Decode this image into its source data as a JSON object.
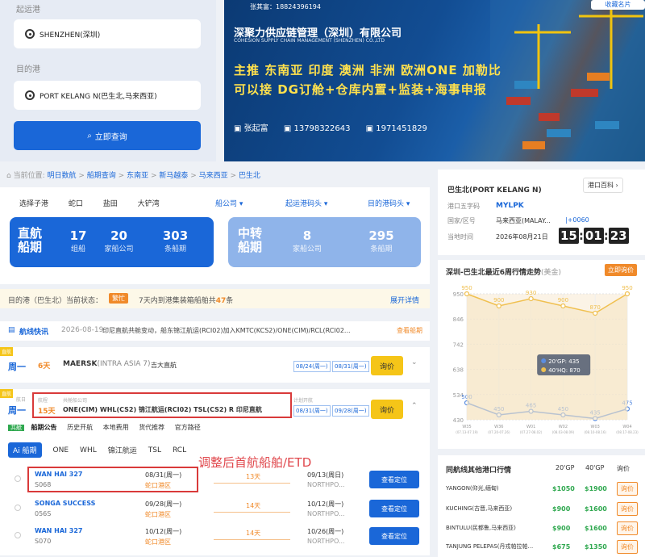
{
  "search": {
    "origin_label": "起运港",
    "origin_value": "SHENZHEN(深圳)",
    "dest_label": "目的港",
    "dest_value": "PORT KELANG N(巴生北,马来西亚)",
    "query_button": "立即查询"
  },
  "banner": {
    "contact_top": "张其富：18824396194",
    "company_cn": "深聚力供应链管理（深圳）有限公司",
    "company_en": "COHESION SUPPLY CHAIN MANAGEMENT (SHENZHEN) CO.,LTD",
    "line1": "主推  东南亚  印度  澳洲  非洲  欧洲ONE  加勒比",
    "line2": "可以接  DG订舱+仓库内置+监装+海事申报",
    "contact_name": "张起富",
    "phone": "13798322643",
    "qq": "1971451829",
    "save_card": "收藏名片"
  },
  "breadcrumb": {
    "prefix": "当前位置:",
    "items": [
      "明日数航",
      "船期查询",
      "东南亚",
      "新马越泰",
      "马来西亚",
      "巴生北"
    ],
    "sep": ">"
  },
  "filters": {
    "ports": [
      "选择子港",
      "蛇口",
      "盐田",
      "大铲湾"
    ],
    "dropdowns": [
      "船公司 ▾",
      "起运港码头 ▾",
      "目的港码头 ▾"
    ]
  },
  "direct": {
    "title1": "直航",
    "title2": "船期",
    "groups": "17",
    "groups_unit": "组船",
    "carriers": "20",
    "carriers_unit": "家船公司",
    "schedules": "303",
    "schedules_unit": "条船期"
  },
  "transit": {
    "title1": "中转",
    "title2": "船期",
    "carriers": "8",
    "carriers_unit": "家船公司",
    "schedules": "295",
    "schedules_unit": "条船期"
  },
  "port_status": {
    "text": "目的港（巴生北）当前状态：",
    "badge": "繁忙",
    "desc_pre": "7天内到港集装箱船舶共",
    "count": "47",
    "desc_post": "条",
    "detail": "展开详情"
  },
  "news": {
    "label": "航线快讯",
    "date": "2026-08-19",
    "text": "印尼直航共舱变动，船东锦江航运(RCI02)加入KMTC(KCS2)/ONE(CIM)/RCL(RCI02...",
    "link": "查看船期"
  },
  "row1": {
    "tag": "直航",
    "day": "周一",
    "days": "6天",
    "carrier": "MAERSK",
    "service": "(INTRA ASIA 7)",
    "route": "吉大直航",
    "date1": "08/24(周一)",
    "date2": "08/31(周一)",
    "ask": "询价"
  },
  "row2": {
    "tag": "直航",
    "day": "周一",
    "sub_day": "航日",
    "days_label": "航程",
    "days": "15天",
    "share_label": "共舱船公司",
    "carriers": "ONE(CIM)  WHL(CS2)  锦江航运(RCI02)  TSL(CS2)  R  印尼直航",
    "plan_label": "计划开航",
    "date1": "08/31(周一)",
    "date2": "09/28(周一)",
    "ask": "询价"
  },
  "subtabs": {
    "badge": "共舱",
    "items": [
      "船期公告",
      "历史开航",
      "本地费用",
      "货代推荐",
      "官方路径"
    ]
  },
  "carrier_tabs": [
    "Ai 船期",
    "ONE",
    "WHL",
    "锦江航运",
    "TSL",
    "RCL"
  ],
  "annotation": "调整后首航船舶/ETD",
  "voyages": [
    {
      "vessel": "WAN HAI 327",
      "voyage": "S068",
      "etd": "08/31(周一)",
      "terminal": "蛇口港区",
      "days": "13天",
      "eta": "09/13(周日)",
      "dest": "NORTHPO...",
      "button": "查看定位"
    },
    {
      "vessel": "SONGA SUCCESS",
      "voyage": "056S",
      "etd": "09/28(周一)",
      "terminal": "蛇口港区",
      "days": "14天",
      "eta": "10/12(周一)",
      "dest": "NORTHPO...",
      "button": "查看定位"
    },
    {
      "vessel": "WAN HAI 327",
      "voyage": "S070",
      "etd": "10/12(周一)",
      "terminal": "蛇口港区",
      "days": "14天",
      "eta": "10/26(周一)",
      "dest": "NORTHPO...",
      "button": "查看定位"
    }
  ],
  "port_info": {
    "title": "巴生北(PORT KELANG N)",
    "encyclopedia": "港口百科 ›",
    "code_label": "港口五字码",
    "code": "MYLPK",
    "country_label": "国家/区号",
    "country": "马来西亚(MALAY...",
    "area_code": "|+0060",
    "time_label": "当地时间",
    "date": "2026年08月21日",
    "time": [
      "15",
      "01",
      "23"
    ]
  },
  "price_trend": {
    "title": "深圳-巴生北最近6周行情走势",
    "unit": "(美金)",
    "button": "立即询价"
  },
  "chart_data": {
    "type": "line",
    "categories": [
      "W35",
      "W36",
      "W01",
      "W02",
      "W03",
      "W04"
    ],
    "date_labels": [
      "(07.13-07.19)",
      "(07.20-07.26)",
      "(07.27-08.02)",
      "(08.03-08.09)",
      "(08.10-08.16)",
      "(08.17-08.23)"
    ],
    "series": [
      {
        "name": "20'GP",
        "values": [
          500,
          450,
          465,
          450,
          435,
          475
        ],
        "color": "#5b8de0"
      },
      {
        "name": "40'HQ",
        "values": [
          950,
          900,
          930,
          900,
          870,
          950
        ],
        "color": "#f0c050"
      }
    ],
    "yticks": [
      430,
      534,
      638,
      742,
      846,
      950
    ],
    "ylim": [
      430,
      950
    ],
    "tooltip": {
      "label_gp": "20'GP: 435",
      "label_hq": "40'HQ: 870"
    }
  },
  "other_ports": {
    "title": "同航线其他港口行情",
    "col_gp": "20'GP",
    "col_hq": "40'GP",
    "col_ask": "询价",
    "rows": [
      {
        "port": "YANGON(仰光,缅甸)",
        "gp": "$1050",
        "hq": "$1900",
        "ask": "询价"
      },
      {
        "port": "KUCHING(古晋,马来西亚)",
        "gp": "$900",
        "hq": "$1600",
        "ask": "询价"
      },
      {
        "port": "BINTULU(民都鲁,马来西亚)",
        "gp": "$900",
        "hq": "$1600",
        "ask": "询价"
      },
      {
        "port": "TANJUNG PELEPAS(丹戎帕拉帕...",
        "gp": "$675",
        "hq": "$1350",
        "ask": "询价"
      }
    ]
  }
}
